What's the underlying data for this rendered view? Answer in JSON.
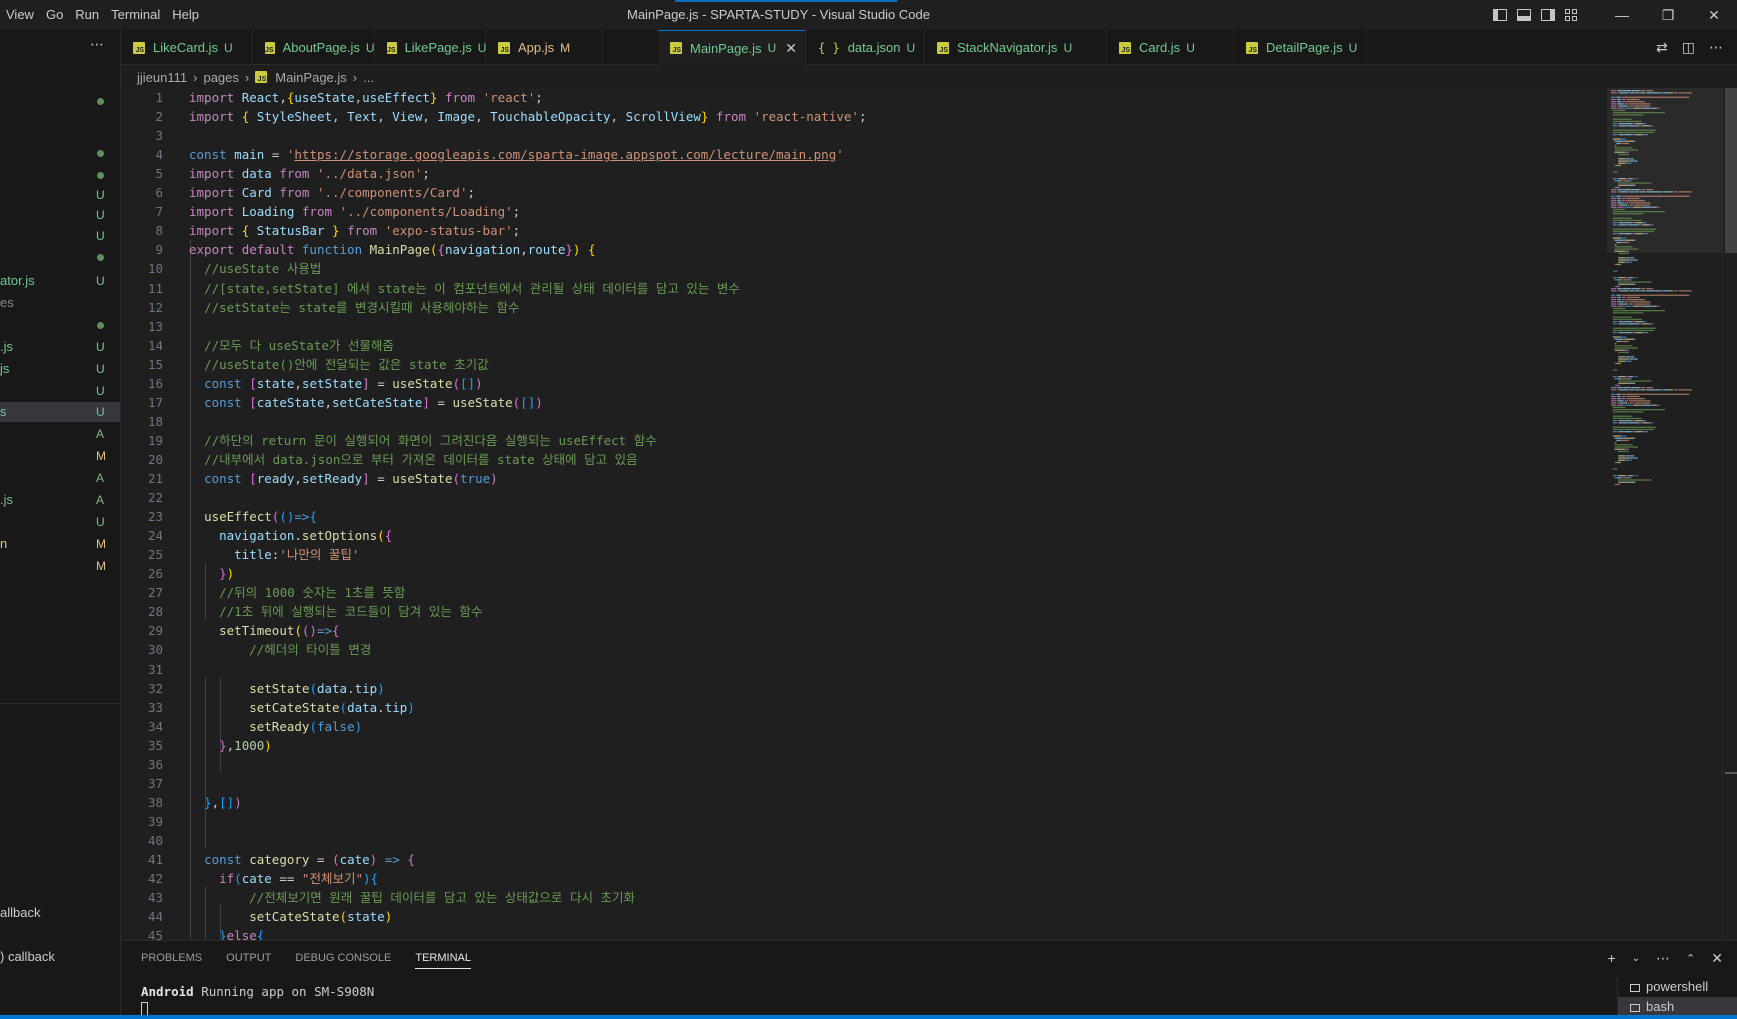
{
  "window": {
    "title": "MainPage.js - SPARTA-STUDY - Visual Studio Code"
  },
  "menu": [
    "View",
    "Go",
    "Run",
    "Terminal",
    "Help"
  ],
  "sidebar": {
    "rows": [
      {
        "name": "",
        "badge": "dot"
      },
      {
        "name": "",
        "badge": "dot"
      },
      {
        "name": "",
        "badge": "dot"
      },
      {
        "name": "",
        "badge": "U"
      },
      {
        "name": "",
        "badge": "U"
      },
      {
        "name": "",
        "badge": "U"
      },
      {
        "name": "",
        "badge": "dot"
      },
      {
        "name": "ator.js",
        "badge": "U"
      },
      {
        "name": "es",
        "badge": ""
      },
      {
        "name": "",
        "badge": "dot"
      },
      {
        "name": ".js",
        "badge": "U"
      },
      {
        "name": "js",
        "badge": "U"
      },
      {
        "name": "",
        "badge": "U"
      },
      {
        "name": "s",
        "badge": "U",
        "selected": true
      },
      {
        "name": "",
        "badge": "A"
      },
      {
        "name": "",
        "badge": "M"
      },
      {
        "name": "",
        "badge": "A"
      },
      {
        "name": ".js",
        "badge": "A"
      },
      {
        "name": "",
        "badge": "U"
      },
      {
        "name": "n",
        "badge": "M"
      },
      {
        "name": "",
        "badge": "M"
      }
    ],
    "outline": [
      "allback",
      ") callback"
    ]
  },
  "tabs": [
    {
      "name": "LikeCard.js",
      "badge": "U",
      "icon": "js"
    },
    {
      "name": "AboutPage.js",
      "badge": "U",
      "icon": "js"
    },
    {
      "name": "LikePage.js",
      "badge": "U",
      "icon": "js"
    },
    {
      "name": "App.js",
      "badge": "M",
      "icon": "js"
    },
    {
      "name": "MainPage.js",
      "badge": "U",
      "icon": "js",
      "active": true
    },
    {
      "name": "data.json",
      "badge": "U",
      "icon": "json"
    },
    {
      "name": "StackNavigator.js",
      "badge": "U",
      "icon": "js"
    },
    {
      "name": "Card.js",
      "badge": "U",
      "icon": "js"
    },
    {
      "name": "DetailPage.js",
      "badge": "U",
      "icon": "js"
    }
  ],
  "breadcrumb": [
    "jjieun111",
    "pages",
    "MainPage.js",
    "..."
  ],
  "code": [
    [
      [
        "kw",
        "import"
      ],
      [
        "pl",
        " "
      ],
      [
        "vr",
        "React"
      ],
      [
        "pl",
        ","
      ],
      [
        "b1",
        "{"
      ],
      [
        "vr",
        "useState"
      ],
      [
        "pl",
        ","
      ],
      [
        "vr",
        "useEffect"
      ],
      [
        "b1",
        "}"
      ],
      [
        "pl",
        " "
      ],
      [
        "kw",
        "from"
      ],
      [
        "pl",
        " "
      ],
      [
        "st",
        "'react'"
      ],
      [
        "pl",
        ";"
      ]
    ],
    [
      [
        "kw",
        "import"
      ],
      [
        "pl",
        " "
      ],
      [
        "b1",
        "{"
      ],
      [
        "pl",
        " "
      ],
      [
        "vr",
        "StyleSheet"
      ],
      [
        "pl",
        ", "
      ],
      [
        "vr",
        "Text"
      ],
      [
        "pl",
        ", "
      ],
      [
        "vr",
        "View"
      ],
      [
        "pl",
        ", "
      ],
      [
        "vr",
        "Image"
      ],
      [
        "pl",
        ", "
      ],
      [
        "vr",
        "TouchableOpacity"
      ],
      [
        "pl",
        ", "
      ],
      [
        "vr",
        "ScrollView"
      ],
      [
        "b1",
        "}"
      ],
      [
        "pl",
        " "
      ],
      [
        "kw",
        "from"
      ],
      [
        "pl",
        " "
      ],
      [
        "st",
        "'react-native'"
      ],
      [
        "pl",
        ";"
      ]
    ],
    [],
    [
      [
        "sb",
        "const"
      ],
      [
        "pl",
        " "
      ],
      [
        "vr",
        "main"
      ],
      [
        "pl",
        " = "
      ],
      [
        "st",
        "'"
      ],
      [
        "url",
        "https://storage.googleapis.com/sparta-image.appspot.com/lecture/main.png"
      ],
      [
        "st",
        "'"
      ]
    ],
    [
      [
        "kw",
        "import"
      ],
      [
        "pl",
        " "
      ],
      [
        "vr",
        "data"
      ],
      [
        "pl",
        " "
      ],
      [
        "kw",
        "from"
      ],
      [
        "pl",
        " "
      ],
      [
        "st",
        "'../data.json'"
      ],
      [
        "pl",
        ";"
      ]
    ],
    [
      [
        "kw",
        "import"
      ],
      [
        "pl",
        " "
      ],
      [
        "vr",
        "Card"
      ],
      [
        "pl",
        " "
      ],
      [
        "kw",
        "from"
      ],
      [
        "pl",
        " "
      ],
      [
        "st",
        "'../components/Card'"
      ],
      [
        "pl",
        ";"
      ]
    ],
    [
      [
        "kw",
        "import"
      ],
      [
        "pl",
        " "
      ],
      [
        "vr",
        "Loading"
      ],
      [
        "pl",
        " "
      ],
      [
        "kw",
        "from"
      ],
      [
        "pl",
        " "
      ],
      [
        "st",
        "'../components/Loading'"
      ],
      [
        "pl",
        ";"
      ]
    ],
    [
      [
        "kw",
        "import"
      ],
      [
        "pl",
        " "
      ],
      [
        "b1",
        "{"
      ],
      [
        "pl",
        " "
      ],
      [
        "vr",
        "StatusBar"
      ],
      [
        "pl",
        " "
      ],
      [
        "b1",
        "}"
      ],
      [
        "pl",
        " "
      ],
      [
        "kw",
        "from"
      ],
      [
        "pl",
        " "
      ],
      [
        "st",
        "'expo-status-bar'"
      ],
      [
        "pl",
        ";"
      ]
    ],
    [
      [
        "kw",
        "export"
      ],
      [
        "pl",
        " "
      ],
      [
        "kw",
        "default"
      ],
      [
        "pl",
        " "
      ],
      [
        "sb",
        "function"
      ],
      [
        "pl",
        " "
      ],
      [
        "fn",
        "MainPage"
      ],
      [
        "b1",
        "("
      ],
      [
        "b2",
        "{"
      ],
      [
        "vr",
        "navigation"
      ],
      [
        "pl",
        ","
      ],
      [
        "vr",
        "route"
      ],
      [
        "b2",
        "}"
      ],
      [
        "b1",
        ")"
      ],
      [
        "pl",
        " "
      ],
      [
        "b1",
        "{"
      ]
    ],
    [
      [
        "pl",
        "  "
      ],
      [
        "cm",
        "//useState 사용법"
      ]
    ],
    [
      [
        "pl",
        "  "
      ],
      [
        "cm",
        "//[state,setState] 에서 state는 이 컴포넌트에서 관리될 상태 데이터를 담고 있는 변수"
      ]
    ],
    [
      [
        "pl",
        "  "
      ],
      [
        "cm",
        "//setState는 state를 변경시킬때 사용해야하는 함수"
      ]
    ],
    [],
    [
      [
        "pl",
        "  "
      ],
      [
        "cm",
        "//모두 다 useState가 선물해줌"
      ]
    ],
    [
      [
        "pl",
        "  "
      ],
      [
        "cm",
        "//useState()안에 전달되는 값은 state 초기값"
      ]
    ],
    [
      [
        "pl",
        "  "
      ],
      [
        "sb",
        "const"
      ],
      [
        "pl",
        " "
      ],
      [
        "b2",
        "["
      ],
      [
        "vr",
        "state"
      ],
      [
        "pl",
        ","
      ],
      [
        "vr",
        "setState"
      ],
      [
        "b2",
        "]"
      ],
      [
        "pl",
        " = "
      ],
      [
        "fn",
        "useState"
      ],
      [
        "b2",
        "("
      ],
      [
        "b3",
        "[]"
      ],
      [
        "b2",
        ")"
      ]
    ],
    [
      [
        "pl",
        "  "
      ],
      [
        "sb",
        "const"
      ],
      [
        "pl",
        " "
      ],
      [
        "b2",
        "["
      ],
      [
        "vr",
        "cateState"
      ],
      [
        "pl",
        ","
      ],
      [
        "vr",
        "setCateState"
      ],
      [
        "b2",
        "]"
      ],
      [
        "pl",
        " = "
      ],
      [
        "fn",
        "useState"
      ],
      [
        "b2",
        "("
      ],
      [
        "b3",
        "[]"
      ],
      [
        "b2",
        ")"
      ]
    ],
    [],
    [
      [
        "pl",
        "  "
      ],
      [
        "cm",
        "//하단의 return 문이 실행되어 화면이 그려진다음 실행되는 useEffect 함수"
      ]
    ],
    [
      [
        "pl",
        "  "
      ],
      [
        "cm",
        "//내부에서 data.json으로 부터 가져온 데이터를 state 상태에 담고 있음"
      ]
    ],
    [
      [
        "pl",
        "  "
      ],
      [
        "sb",
        "const"
      ],
      [
        "pl",
        " "
      ],
      [
        "b2",
        "["
      ],
      [
        "vr",
        "ready"
      ],
      [
        "pl",
        ","
      ],
      [
        "vr",
        "setReady"
      ],
      [
        "b2",
        "]"
      ],
      [
        "pl",
        " = "
      ],
      [
        "fn",
        "useState"
      ],
      [
        "b2",
        "("
      ],
      [
        "sb",
        "true"
      ],
      [
        "b2",
        ")"
      ]
    ],
    [],
    [
      [
        "pl",
        "  "
      ],
      [
        "fn",
        "useEffect"
      ],
      [
        "b2",
        "("
      ],
      [
        "b3",
        "()"
      ],
      [
        "sb",
        "=>"
      ],
      [
        "b3",
        "{"
      ]
    ],
    [
      [
        "pl",
        "    "
      ],
      [
        "vr",
        "navigation"
      ],
      [
        "pl",
        "."
      ],
      [
        "fn",
        "setOptions"
      ],
      [
        "b1",
        "("
      ],
      [
        "b2",
        "{"
      ]
    ],
    [
      [
        "pl",
        "      "
      ],
      [
        "vr",
        "title"
      ],
      [
        "pl",
        ":"
      ],
      [
        "st",
        "'나만의 꿀팁'"
      ]
    ],
    [
      [
        "pl",
        "    "
      ],
      [
        "b2",
        "}"
      ],
      [
        "b1",
        ")"
      ]
    ],
    [
      [
        "pl",
        "    "
      ],
      [
        "cm",
        "//뒤의 1000 숫자는 1초를 뜻함"
      ]
    ],
    [
      [
        "pl",
        "    "
      ],
      [
        "cm",
        "//1초 뒤에 실행되는 코드들이 담겨 있는 함수"
      ]
    ],
    [
      [
        "pl",
        "    "
      ],
      [
        "fn",
        "setTimeout"
      ],
      [
        "b1",
        "("
      ],
      [
        "b2",
        "()"
      ],
      [
        "sb",
        "=>"
      ],
      [
        "b2",
        "{"
      ]
    ],
    [
      [
        "pl",
        "        "
      ],
      [
        "cm",
        "//헤더의 타이틀 변경"
      ]
    ],
    [],
    [
      [
        "pl",
        "        "
      ],
      [
        "fn",
        "setState"
      ],
      [
        "b3",
        "("
      ],
      [
        "vr",
        "data"
      ],
      [
        "pl",
        "."
      ],
      [
        "vr",
        "tip"
      ],
      [
        "b3",
        ")"
      ]
    ],
    [
      [
        "pl",
        "        "
      ],
      [
        "fn",
        "setCateState"
      ],
      [
        "b3",
        "("
      ],
      [
        "vr",
        "data"
      ],
      [
        "pl",
        "."
      ],
      [
        "vr",
        "tip"
      ],
      [
        "b3",
        ")"
      ]
    ],
    [
      [
        "pl",
        "        "
      ],
      [
        "fn",
        "setReady"
      ],
      [
        "b3",
        "("
      ],
      [
        "sb",
        "false"
      ],
      [
        "b3",
        ")"
      ]
    ],
    [
      [
        "pl",
        "    "
      ],
      [
        "b2",
        "}"
      ],
      [
        "pl",
        ","
      ],
      [
        "nm",
        "1000"
      ],
      [
        "b1",
        ")"
      ]
    ],
    [],
    [],
    [
      [
        "pl",
        "  "
      ],
      [
        "b3",
        "}"
      ],
      [
        "pl",
        ","
      ],
      [
        "b3",
        "[]"
      ],
      [
        "b2",
        ")"
      ]
    ],
    [],
    [],
    [
      [
        "pl",
        "  "
      ],
      [
        "sb",
        "const"
      ],
      [
        "pl",
        " "
      ],
      [
        "fn",
        "category"
      ],
      [
        "pl",
        " = "
      ],
      [
        "b2",
        "("
      ],
      [
        "vr",
        "cate"
      ],
      [
        "b2",
        ")"
      ],
      [
        "pl",
        " "
      ],
      [
        "sb",
        "=>"
      ],
      [
        "pl",
        " "
      ],
      [
        "b2",
        "{"
      ]
    ],
    [
      [
        "pl",
        "    "
      ],
      [
        "kw",
        "if"
      ],
      [
        "b3",
        "("
      ],
      [
        "vr",
        "cate"
      ],
      [
        "pl",
        " == "
      ],
      [
        "st",
        "\"전체보기\""
      ],
      [
        "b3",
        ")"
      ],
      [
        "b3",
        "{"
      ]
    ],
    [
      [
        "pl",
        "        "
      ],
      [
        "cm",
        "//전체보기면 원래 꿀팁 데이터를 담고 있는 상태값으로 다시 초기화"
      ]
    ],
    [
      [
        "pl",
        "        "
      ],
      [
        "fn",
        "setCateState"
      ],
      [
        "b1",
        "("
      ],
      [
        "vr",
        "state"
      ],
      [
        "b1",
        ")"
      ]
    ],
    [
      [
        "pl",
        "    "
      ],
      [
        "b3",
        "}"
      ],
      [
        "kw",
        "else"
      ],
      [
        "b3",
        "{"
      ]
    ]
  ],
  "panel": {
    "tabs": [
      "PROBLEMS",
      "OUTPUT",
      "DEBUG CONSOLE",
      "TERMINAL"
    ],
    "active_tab": "TERMINAL",
    "terminal_prefix": "Android",
    "terminal_text": " Running app on SM-S908N",
    "terminals": [
      "powershell",
      "bash"
    ]
  },
  "colors": {
    "accent": "#0078d4",
    "untracked": "#73c991",
    "modified": "#e2c08d",
    "added": "#81b88b"
  }
}
